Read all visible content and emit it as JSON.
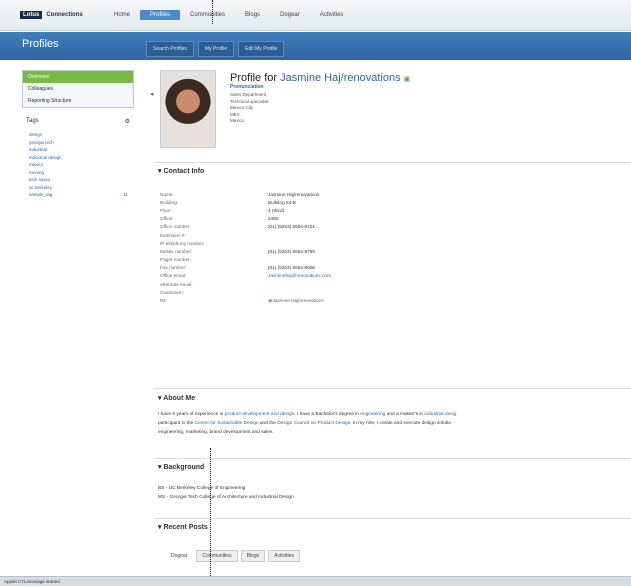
{
  "brand": {
    "lotus": "Lotus",
    "connections": "Connections"
  },
  "nav": [
    "Home",
    "Profiles",
    "Communities",
    "Blogs",
    "Dogear",
    "Activities"
  ],
  "banner": {
    "title": "Profiles"
  },
  "subtabs": [
    "Search Profiles",
    "My Profile",
    "Edit My Profile"
  ],
  "leftnav": {
    "items": [
      "Overview",
      "Colleagues",
      "Reporting Structure"
    ],
    "tags_header": "Tags",
    "tags": [
      {
        "label": "design",
        "count": ""
      },
      {
        "label": "georgia tech",
        "count": ""
      },
      {
        "label": "industrial",
        "count": ""
      },
      {
        "label": "industrial design",
        "count": ""
      },
      {
        "label": "mexico",
        "count": ""
      },
      {
        "label": "running",
        "count": ""
      },
      {
        "label": "tech savvy",
        "count": ""
      },
      {
        "label": "uc berkeley",
        "count": ""
      },
      {
        "label": "sample_tag",
        "count": "11"
      }
    ]
  },
  "profile": {
    "title_prefix": "Profile for",
    "name": "Jasmine Haj/renovations",
    "pronunciation": "Pronunciation",
    "info": [
      "Sales Department",
      "Technical specialist",
      "Mexico City",
      "MEX",
      "Mexico"
    ]
  },
  "contact": {
    "header": "Contact Info",
    "rows": [
      {
        "k": "Name:",
        "v": "Jasmine Haj/renovations",
        "t": ""
      },
      {
        "k": "Building:",
        "v": "Building 54-B",
        "t": ""
      },
      {
        "k": "Floor:",
        "v": "4 (third)",
        "t": ""
      },
      {
        "k": "Office:",
        "v": "2480",
        "t": ""
      },
      {
        "k": "Office number:",
        "v": "(01) (5253) 5554-8101",
        "t": ""
      },
      {
        "k": "Extension #:",
        "v": "",
        "t": ""
      },
      {
        "k": "IP telephony number:",
        "v": "",
        "t": ""
      },
      {
        "k": "Mobile number:",
        "v": "(01) (5253) 5554-8769",
        "t": ""
      },
      {
        "k": "Pager number:",
        "v": "",
        "t": ""
      },
      {
        "k": "Fax number:",
        "v": "(01) (5253) 5554-8008",
        "t": ""
      },
      {
        "k": "Office email:",
        "v": "Jasminehaj@renovations.com",
        "t": "link"
      },
      {
        "k": "Alternate email:",
        "v": "",
        "t": ""
      },
      {
        "k": "Custmnem:",
        "v": "",
        "t": ""
      },
      {
        "k": "IM:",
        "v": "Jasmine Haj/renovations",
        "t": "green"
      }
    ]
  },
  "about": {
    "header": "About Me",
    "p1": "I have 8 years of experience in ",
    "l1": "product development and design",
    "p2": ". I have a Bachelor's degree in ",
    "l2": "engineering",
    "p3": " and a master's in ",
    "l3": "industrial desig",
    "p4": "participant in the ",
    "l4": "Centre for Sustainable Design",
    "p5": " and the ",
    "l5": "Design Council on Product Design",
    "p6": ". In my role, I create and execute design solutio",
    "p7": "engineering, marketing, brand development and sales."
  },
  "background": {
    "header": "Background",
    "lines": [
      "BS - UC Berkeley College of Engineering",
      "MS - Georgia Tech College of Architecture and Industrial Design"
    ]
  },
  "recent": {
    "header": "Recent Posts",
    "tabs": [
      "Dogear",
      "Communities",
      "Blogs",
      "Activities"
    ]
  },
  "status": "Applet CTLmessage started"
}
